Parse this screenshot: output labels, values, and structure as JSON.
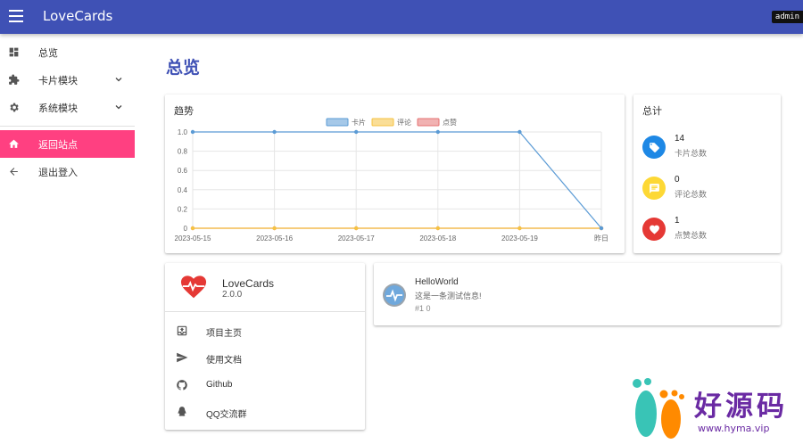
{
  "appbar": {
    "title": "LoveCards",
    "user": "admin"
  },
  "sidebar": {
    "items": [
      {
        "label": "总览"
      },
      {
        "label": "卡片模块"
      },
      {
        "label": "系统模块"
      },
      {
        "label": "返回站点"
      },
      {
        "label": "退出登入"
      }
    ]
  },
  "main": {
    "title": "总览"
  },
  "trend": {
    "title": "趋势",
    "chart_data": {
      "type": "line",
      "categories": [
        "2023-05-15",
        "2023-05-16",
        "2023-05-17",
        "2023-05-18",
        "2023-05-19",
        "昨日"
      ],
      "series": [
        {
          "name": "卡片",
          "values": [
            1,
            1,
            1,
            1,
            1,
            0
          ],
          "color": "#5b9bd5"
        },
        {
          "name": "评论",
          "values": [
            0,
            0,
            0,
            0,
            0,
            0
          ],
          "color": "#f5c342"
        },
        {
          "name": "点赞",
          "values": [
            0,
            0,
            0,
            0,
            0,
            0
          ],
          "color": "#e57373"
        }
      ],
      "ylim": [
        0,
        1
      ],
      "yticks": [
        "0",
        "0.2",
        "0.4",
        "0.6",
        "0.8",
        "1.0"
      ],
      "grid": true,
      "legend": "top"
    }
  },
  "totals": {
    "title": "总计",
    "stats": [
      {
        "value": "14",
        "label": "卡片总数",
        "color": "#1e88e5",
        "icon": "card-icon"
      },
      {
        "value": "0",
        "label": "评论总数",
        "color": "#fdd835",
        "icon": "comment-icon"
      },
      {
        "value": "1",
        "label": "点赞总数",
        "color": "#e53935",
        "icon": "heart-icon"
      }
    ]
  },
  "app": {
    "name": "LoveCards",
    "version": "2.0.0",
    "links": [
      {
        "label": "项目主页"
      },
      {
        "label": "使用文档"
      },
      {
        "label": "Github"
      },
      {
        "label": "QQ交流群"
      }
    ]
  },
  "message": {
    "title": "HelloWorld",
    "body": "这是一条测试信息!",
    "meta": "#1 0"
  },
  "watermark": {
    "text": "好源码",
    "url": "www.hyma.vip"
  }
}
